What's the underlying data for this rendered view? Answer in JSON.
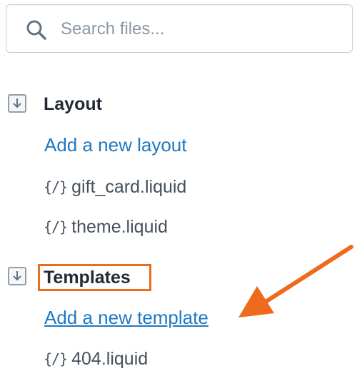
{
  "search": {
    "placeholder": "Search files...",
    "value": "",
    "icon": "search-icon"
  },
  "sections": [
    {
      "title": "Layout",
      "icon": "folder-download-icon",
      "add_link": "Add a new layout",
      "files": [
        "gift_card.liquid",
        "theme.liquid"
      ]
    },
    {
      "title": "Templates",
      "icon": "folder-download-icon",
      "add_link": "Add a new template",
      "files": [
        "404.liquid"
      ]
    }
  ],
  "file_icon_glyph": "{/}",
  "colors": {
    "link": "#1f78c1",
    "annotation": "#ee6a1c",
    "text": "#212b36",
    "muted_text": "#454f5b"
  }
}
